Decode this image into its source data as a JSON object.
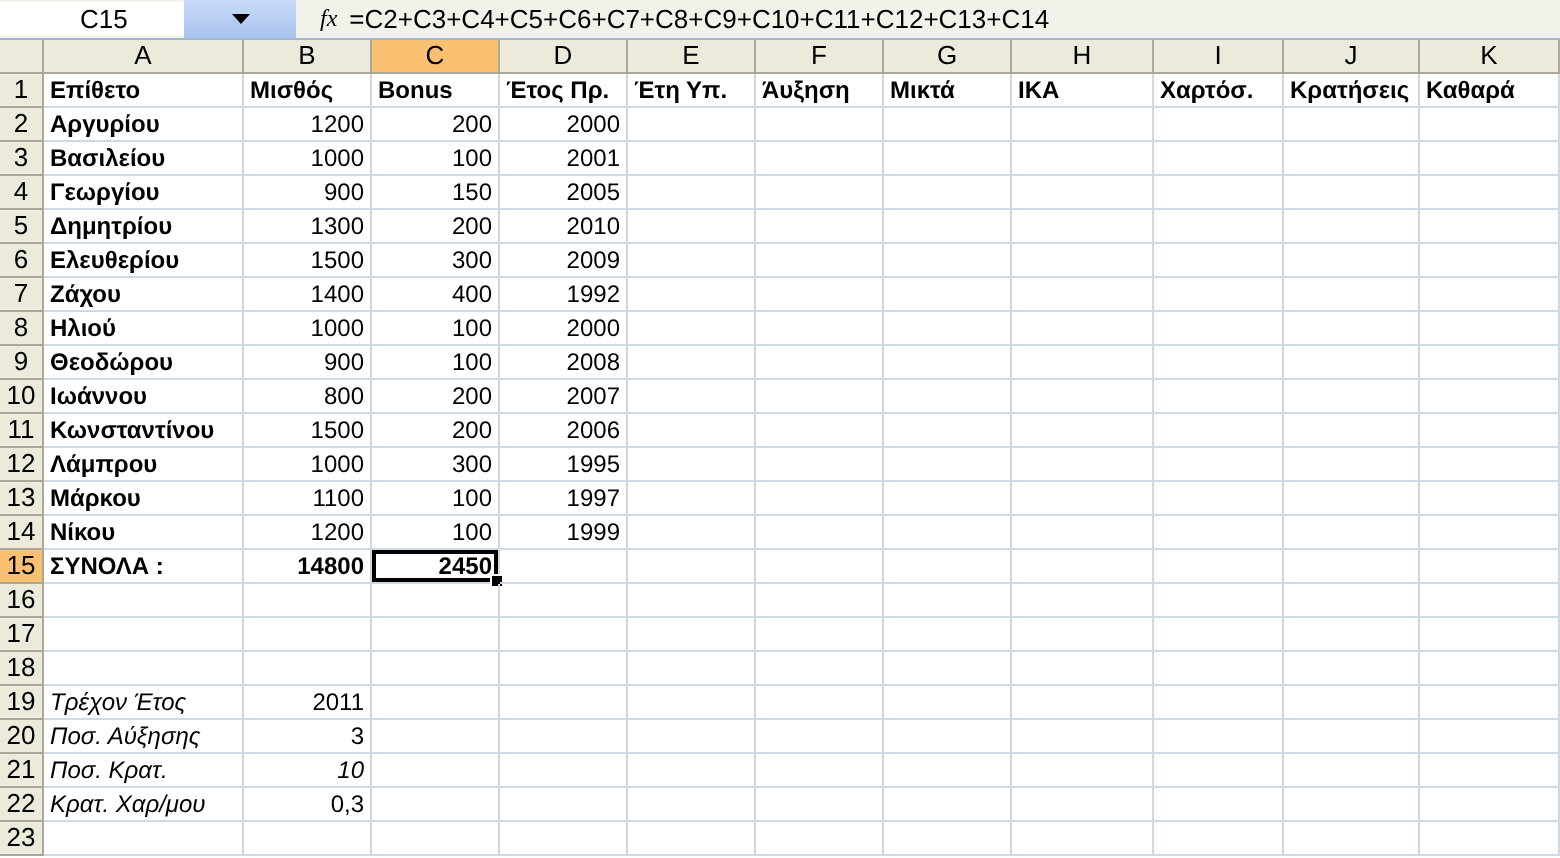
{
  "name_box": "C15",
  "fx_label": "fx",
  "formula": "=C2+C3+C4+C5+C6+C7+C8+C9+C10+C11+C12+C13+C14",
  "columns": [
    {
      "label": "A",
      "selected": false
    },
    {
      "label": "B",
      "selected": false
    },
    {
      "label": "C",
      "selected": true
    },
    {
      "label": "D",
      "selected": false
    },
    {
      "label": "E",
      "selected": false
    },
    {
      "label": "F",
      "selected": false
    },
    {
      "label": "G",
      "selected": false
    },
    {
      "label": "H",
      "selected": false
    },
    {
      "label": "I",
      "selected": false
    },
    {
      "label": "J",
      "selected": false
    },
    {
      "label": "K",
      "selected": false
    }
  ],
  "rows": [
    {
      "number": "1",
      "selected": false,
      "kind": "header",
      "texts": [
        "Επίθετο",
        "Μισθός",
        "Bonus",
        "Έτος Πρ.",
        "Έτη Υπ.",
        "Άυξηση",
        "Μικτά",
        "ΙΚΑ",
        "Χαρτόσ.",
        "Κρατήσεις",
        "Καθαρά"
      ]
    },
    {
      "number": "2",
      "selected": false,
      "kind": "employee",
      "name": "Αργυρίου",
      "salary": "1200",
      "bonus": "200",
      "year": "2000"
    },
    {
      "number": "3",
      "selected": false,
      "kind": "employee",
      "name": "Βασιλείου",
      "salary": "1000",
      "bonus": "100",
      "year": "2001"
    },
    {
      "number": "4",
      "selected": false,
      "kind": "employee",
      "name": "Γεωργίου",
      "salary": "900",
      "bonus": "150",
      "year": "2005"
    },
    {
      "number": "5",
      "selected": false,
      "kind": "employee",
      "name": "Δημητρίου",
      "salary": "1300",
      "bonus": "200",
      "year": "2010"
    },
    {
      "number": "6",
      "selected": false,
      "kind": "employee",
      "name": "Ελευθερίου",
      "salary": "1500",
      "bonus": "300",
      "year": "2009"
    },
    {
      "number": "7",
      "selected": false,
      "kind": "employee",
      "name": "Ζάχου",
      "salary": "1400",
      "bonus": "400",
      "year": "1992"
    },
    {
      "number": "8",
      "selected": false,
      "kind": "employee",
      "name": "Ηλιού",
      "salary": "1000",
      "bonus": "100",
      "year": "2000"
    },
    {
      "number": "9",
      "selected": false,
      "kind": "employee",
      "name": "Θεοδώρου",
      "salary": "900",
      "bonus": "100",
      "year": "2008"
    },
    {
      "number": "10",
      "selected": false,
      "kind": "employee",
      "name": "Ιωάννου",
      "salary": "800",
      "bonus": "200",
      "year": "2007"
    },
    {
      "number": "11",
      "selected": false,
      "kind": "employee",
      "name": "Κωνσταντίνου",
      "salary": "1500",
      "bonus": "200",
      "year": "2006"
    },
    {
      "number": "12",
      "selected": false,
      "kind": "employee",
      "name": "Λάμπρου",
      "salary": "1000",
      "bonus": "300",
      "year": "1995"
    },
    {
      "number": "13",
      "selected": false,
      "kind": "employee",
      "name": "Μάρκου",
      "salary": "1100",
      "bonus": "100",
      "year": "1997"
    },
    {
      "number": "14",
      "selected": false,
      "kind": "employee",
      "name": "Νίκου",
      "salary": "1200",
      "bonus": "100",
      "year": "1999"
    },
    {
      "number": "15",
      "selected": true,
      "kind": "total",
      "label": "ΣΥΝΟΛΑ :",
      "salary": "14800",
      "bonus": "2450"
    },
    {
      "number": "16",
      "selected": false,
      "kind": "blank"
    },
    {
      "number": "17",
      "selected": false,
      "kind": "blank"
    },
    {
      "number": "18",
      "selected": false,
      "kind": "blank"
    },
    {
      "number": "19",
      "selected": false,
      "kind": "param",
      "label": "Τρέχον Έτος",
      "value": "2011",
      "value_italic": false
    },
    {
      "number": "20",
      "selected": false,
      "kind": "param",
      "label": "Ποσ. Αύξησης",
      "value": "3",
      "value_italic": false
    },
    {
      "number": "21",
      "selected": false,
      "kind": "param",
      "label": "Ποσ. Κρατ.",
      "value": "10",
      "value_italic": true
    },
    {
      "number": "22",
      "selected": false,
      "kind": "param",
      "label": "Κρατ. Χαρ/μου",
      "value": "0,3",
      "value_italic": false
    },
    {
      "number": "23",
      "selected": false,
      "kind": "blank"
    }
  ]
}
